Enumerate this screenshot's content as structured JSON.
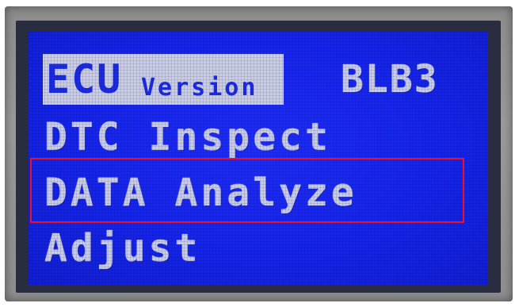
{
  "screen": {
    "menu": {
      "ecu_label": "ECU",
      "version_label": "Version",
      "version_value": "BLB3",
      "items": [
        {
          "label": "DTC Inspect"
        },
        {
          "label": "DATA Analyze"
        },
        {
          "label": "Adjust"
        }
      ],
      "selected_index": 1
    },
    "colors": {
      "lcd_background": "#1424f2",
      "lcd_text": "#c8cde6",
      "highlight_background": "#c9cde2",
      "selection_border": "#e8132b",
      "bezel": "#8c8c8c"
    }
  }
}
